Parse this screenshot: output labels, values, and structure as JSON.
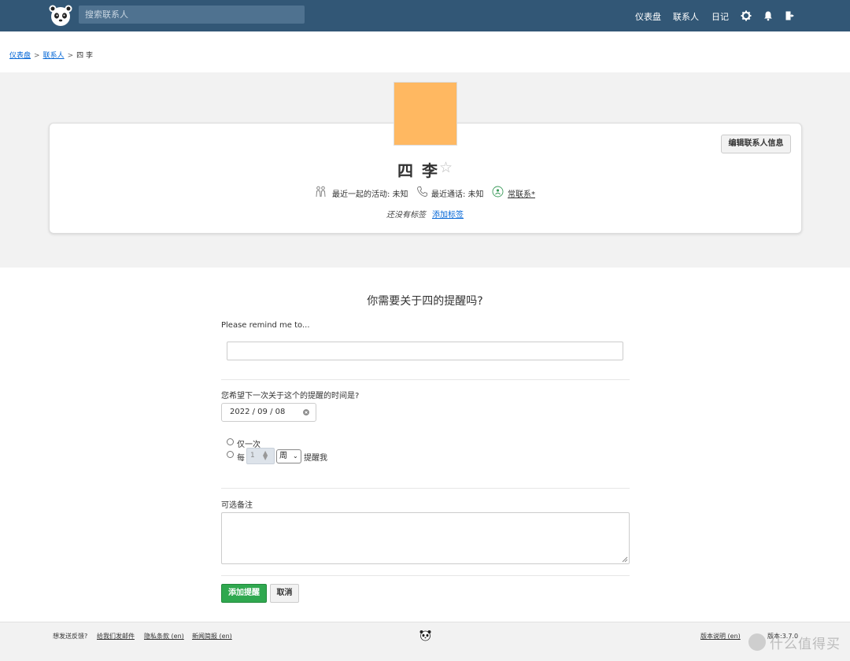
{
  "header": {
    "search_placeholder": "搜索联系人",
    "nav": [
      "仪表盘",
      "联系人",
      "日记"
    ],
    "icons": [
      "gear-icon",
      "bell-icon",
      "logout-icon"
    ]
  },
  "breadcrumb": {
    "items": [
      "仪表盘",
      "联系人"
    ],
    "current": "四 李"
  },
  "contact": {
    "name": "四 李",
    "avatar_color": "#ffb861",
    "edit_label": "编辑联系人信息",
    "activity": "最近一起的活动: 未知",
    "call": "最近通话: 未知",
    "frequency_link": "常联系*",
    "no_tags": "还没有标签",
    "add_tag": "添加标签"
  },
  "form": {
    "title": "你需要关于四的提醒吗?",
    "remind_label": "Please remind me to...",
    "remind_value": "",
    "when_label": "您希望下一次关于这个的提醒的时间是?",
    "date_value": "2022 / 09 / 08",
    "once_label": "仅一次",
    "every_label": "每",
    "every_number": "1",
    "every_unit": "周",
    "remind_me": "提醒我",
    "note_label": "可选备注",
    "submit_label": "添加提醒",
    "cancel_label": "取消",
    "submit_color": "#2fa84f"
  },
  "footer": {
    "feedback": "想发送反馈?",
    "email_link": "给我们发邮件",
    "privacy_link": "隐私条款 (en)",
    "news_link": "新闻简报 (en)",
    "release_link": "版本说明 (en)",
    "version": "版本:3.7.0",
    "watermark": "什么值得买"
  },
  "colors": {
    "topbar": "#325776",
    "link": "#0366d6"
  }
}
